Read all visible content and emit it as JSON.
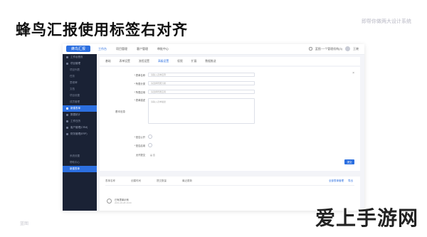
{
  "slide": {
    "heading": "蜂鸟汇报使用标签右对齐",
    "corner_tag": "即帮你做两大设计系统",
    "bottom_left": "蓝图",
    "watermark": "爱上手游网"
  },
  "app": {
    "logo": "蜂鸟汇报",
    "top_nav": [
      "工作台",
      "项目管理",
      "客户管理",
      "审批中心"
    ],
    "top_right": {
      "org": "蓝图·一个管理机构(3)",
      "user": "王晓"
    },
    "sidebar": [
      {
        "label": "工作台首页",
        "level": 0,
        "active": false
      },
      {
        "label": "项目管理",
        "level": 0,
        "active": false
      },
      {
        "label": "项目列表",
        "level": 1,
        "active": false
      },
      {
        "label": "任务",
        "level": 1,
        "active": false
      },
      {
        "label": "里程碑",
        "level": 1,
        "active": false
      },
      {
        "label": "文档",
        "level": 1,
        "active": false
      },
      {
        "label": "项目设置",
        "level": 1,
        "active": false
      },
      {
        "label": "成员管理",
        "level": 1,
        "active": false
      },
      {
        "label": "新建表单",
        "level": 0,
        "active": true
      },
      {
        "label": "数据统计",
        "level": 0,
        "active": false
      },
      {
        "label": "工作日历",
        "level": 0,
        "active": false
      },
      {
        "label": "客户管理(CRM)",
        "level": 0,
        "active": false
      },
      {
        "label": "财务管理(ERP)",
        "level": 0,
        "active": false
      }
    ],
    "sidebar_bottom": [
      {
        "label": "系统设置",
        "active": false
      },
      {
        "label": "帮助中心",
        "active": false
      },
      {
        "label": "新建表单",
        "active": true
      }
    ],
    "tabs": [
      "基础",
      "表单设置",
      "流程设置",
      "高级设置",
      "权限",
      "扩展",
      "数据推送"
    ],
    "active_tab_index": 3,
    "form": {
      "group_label": "基本信息",
      "close_icon": "×",
      "fields": [
        {
          "label": "* 表单名称",
          "placeholder": "请输入表单名称"
        },
        {
          "label": "* 所属分类",
          "placeholder": "请选择所属分类"
        },
        {
          "label": "* 所属应用",
          "placeholder": "请选择所属应用"
        }
      ],
      "textarea": {
        "label": "* 表单描述",
        "placeholder": "请输入表单描述"
      },
      "radios": [
        {
          "label": "* 是否公开",
          "option": ""
        },
        {
          "label": "* 是否启用",
          "option": ""
        },
        {
          "label": "允许提交",
          "option": "是  否"
        }
      ],
      "submit_label": "提交"
    },
    "list": {
      "headers": [
        "表单名称",
        "创建时间",
        "提交数量",
        "最近更新"
      ],
      "actions": [
        "全部表单管理",
        "导出"
      ],
      "row": {
        "title": "已有表单示例",
        "subtitle": "2021-06-28 16:00"
      }
    }
  }
}
